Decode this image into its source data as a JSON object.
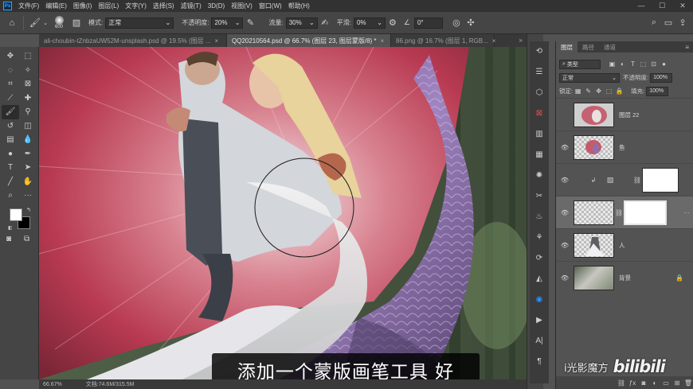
{
  "app": {
    "logo": "Ps",
    "menu": [
      "文件(F)",
      "编辑(E)",
      "图像(I)",
      "图层(L)",
      "文字(Y)",
      "选择(S)",
      "滤镜(T)",
      "3D(D)",
      "视图(V)",
      "窗口(W)",
      "帮助(H)"
    ],
    "window_controls": [
      "—",
      "☐",
      "✕"
    ]
  },
  "options": {
    "home_icon": "home-icon",
    "brush_size": "600",
    "mode_label": "模式:",
    "mode_value": "正常",
    "opacity_label": "不透明度:",
    "opacity_value": "20%",
    "flow_label": "流量:",
    "flow_value": "30%",
    "smoothing_label": "平滑:",
    "smoothing_value": "0%",
    "angle_value": "0°"
  },
  "tabs": [
    {
      "label": "ali-choubin-tZnbzaUW52M-unsplash.psd @ 19.5% (图层 ...",
      "close": "×",
      "active": false
    },
    {
      "label": "QQ20210564.psd @ 66.7% (图层 23, 图层蒙版/8) *",
      "close": "×",
      "active": true
    },
    {
      "label": "86.png @ 16.7% (图层 1, RGB...",
      "close": "×",
      "active": false
    }
  ],
  "status": {
    "zoom": "66.67%",
    "doc": "文档:74.6M/315.5M"
  },
  "subtitle": "添加一个蒙版画笔工具 好",
  "watermark": {
    "text": "i光影魔方",
    "logo": "bilibili"
  },
  "layers_panel": {
    "tabs": [
      "图层",
      "路径",
      "通道"
    ],
    "filter_label": "类型",
    "blend_mode": "正常",
    "opacity_label": "不透明度:",
    "opacity_value": "100%",
    "lock_label": "锁定:",
    "fill_label": "填充:",
    "fill_value": "100%",
    "layers": [
      {
        "name": "图层 22"
      },
      {
        "name": "鱼"
      },
      {
        "name": ""
      },
      {
        "name": ""
      },
      {
        "name": "人"
      },
      {
        "name": "背景"
      }
    ]
  },
  "colors": {
    "ui_dark": "#323232",
    "ui_panel": "#454545",
    "accent_blue": "#31a8ff",
    "fin_red": "#c2455a",
    "scale_purple": "#8e6fa8"
  }
}
